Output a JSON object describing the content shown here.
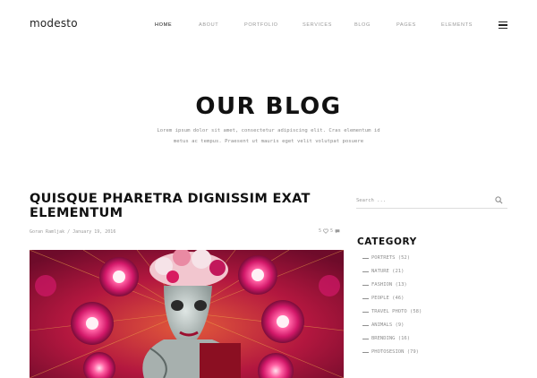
{
  "header": {
    "logo": "modesto",
    "nav": [
      {
        "label": "HOME",
        "active": true
      },
      {
        "label": "ABOUT",
        "active": false
      },
      {
        "label": "PORTFOLIO",
        "active": false
      },
      {
        "label": "SERVICES",
        "active": false
      },
      {
        "label": "BLOG",
        "active": false
      },
      {
        "label": "PAGES",
        "active": false
      },
      {
        "label": "ELEMENTS",
        "active": false
      }
    ],
    "menu_icon": "hamburger-icon"
  },
  "hero": {
    "title": "OUR BLOG",
    "subtitle_line1": "Lorem ipsum dolor sit amet, consectetur adipiscing elit. Cras elementum id",
    "subtitle_line2": "metus ac tempus. Praesent ut mauris eget velit volutpat posuere"
  },
  "post": {
    "title": "QUISQUE PHARETRA DIGNISSIM EXAT ELEMENTUM",
    "meta": "Goran Ramljak / January 19, 2016",
    "likes": "5",
    "comments": "5",
    "like_icon": "heart-icon",
    "comment_icon": "comment-icon"
  },
  "sidebar": {
    "search_placeholder": "Search ...",
    "search_icon": "search-icon",
    "category_heading": "CATEGORY",
    "categories": [
      {
        "label": "PORTRETS (52)"
      },
      {
        "label": "NATURE (21)"
      },
      {
        "label": "FASHION (13)"
      },
      {
        "label": "PEOPLE (46)"
      },
      {
        "label": "TRAVEL PHOTO (58)"
      },
      {
        "label": "ANIMALS (9)"
      },
      {
        "label": "BRENDING (16)"
      },
      {
        "label": "PHOTOSESION (79)"
      }
    ]
  },
  "colors": {
    "text": "#111111",
    "muted": "#9a9a9a",
    "image_primary": "#b01540"
  }
}
